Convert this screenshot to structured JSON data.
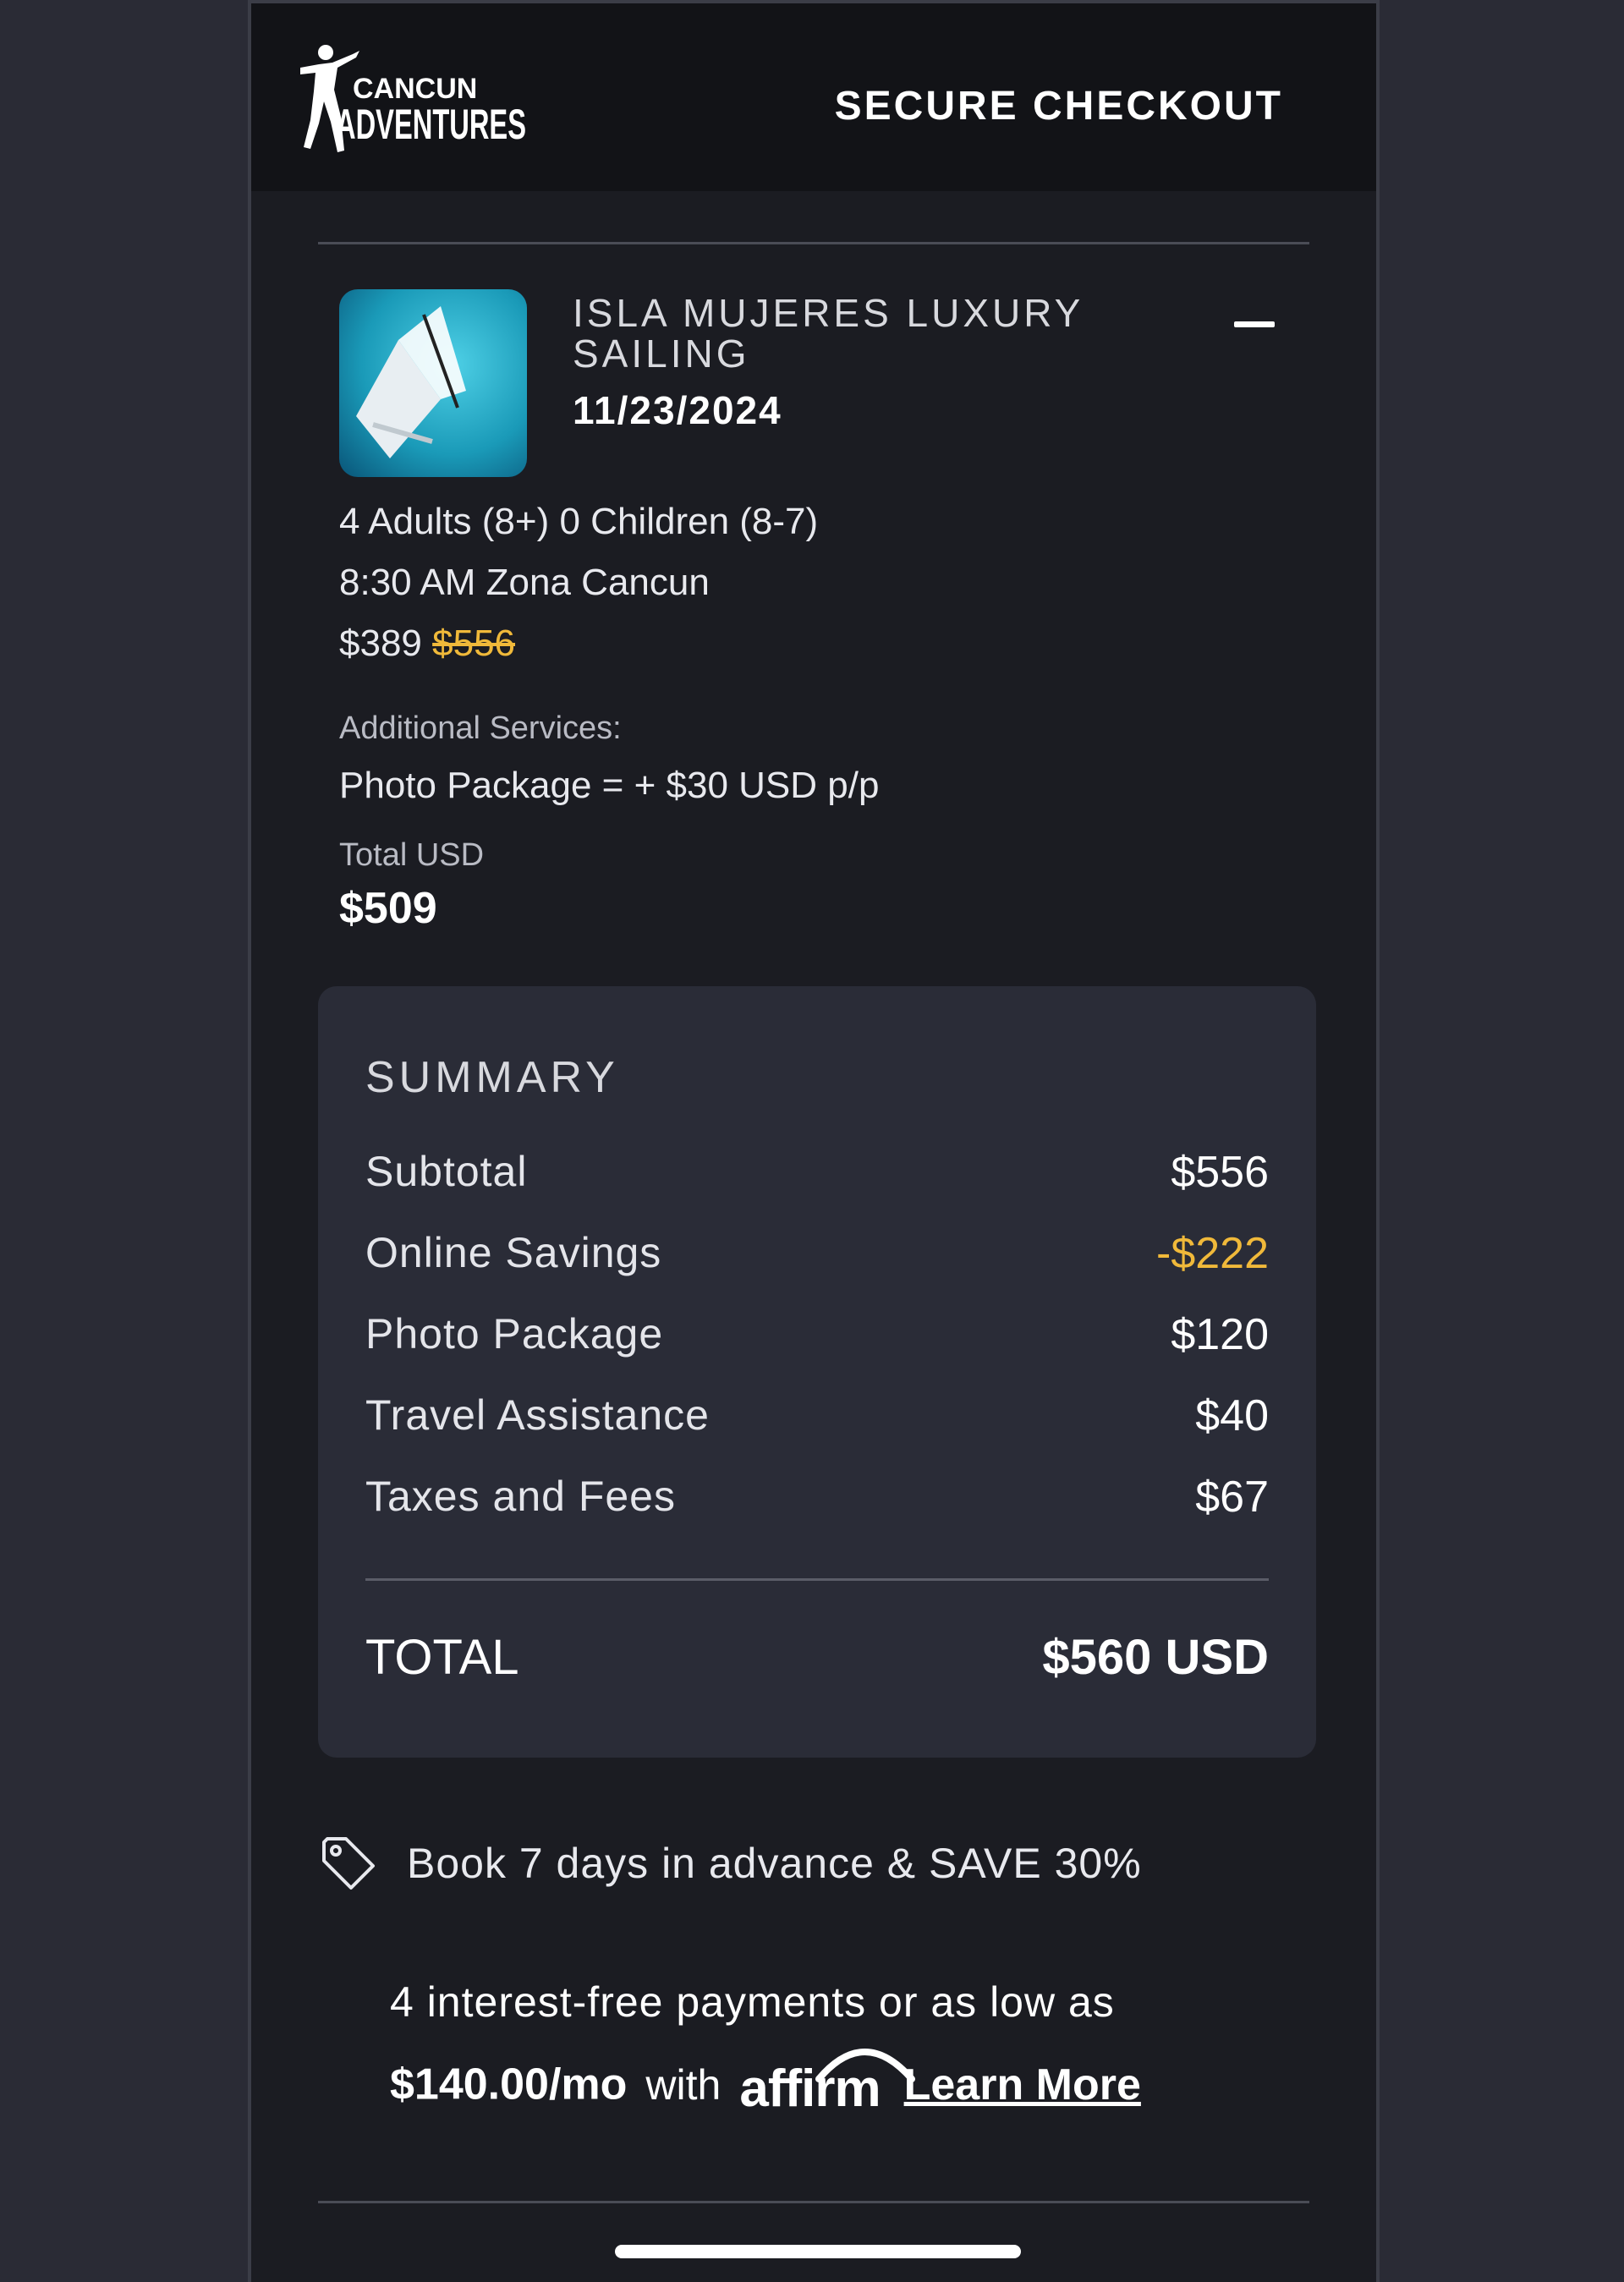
{
  "header": {
    "logo_line1": "CANCUN",
    "logo_line2": "ADVENTURES",
    "title": "SECURE CHECKOUT"
  },
  "tour": {
    "name": "ISLA MUJERES LUXURY SAILING",
    "date": "11/23/2024",
    "guests": "4 Adults (8+) 0 Children (8-7)",
    "time_location": "8:30 AM Zona Cancun",
    "price": "$389",
    "original_price": "$556",
    "additional_label": "Additional Services:",
    "additional_item": "Photo Package = + $30 USD p/p",
    "total_label": "Total USD",
    "total_value": "$509"
  },
  "summary": {
    "title": "SUMMARY",
    "rows": [
      {
        "label": "Subtotal",
        "value": "$556"
      },
      {
        "label": "Online Savings",
        "value": "-$222"
      },
      {
        "label": "Photo Package",
        "value": "$120"
      },
      {
        "label": "Travel Assistance",
        "value": "$40"
      },
      {
        "label": "Taxes and Fees",
        "value": "$67"
      }
    ],
    "total_label": "TOTAL",
    "total_value": "$560 USD"
  },
  "promo": {
    "text": "Book 7 days in advance & SAVE 30%",
    "icon": "tag-icon"
  },
  "affirm": {
    "line1": "4 interest-free payments or as low as",
    "amount": "$140.00/mo",
    "with": "with",
    "brand": "affirm",
    "learn_more": "Learn More"
  },
  "colors": {
    "background": "#2a2b35",
    "panel": "#1b1c22",
    "header": "#121317",
    "summary_card": "#2a2c37",
    "accent_savings": "#f0b93a"
  }
}
